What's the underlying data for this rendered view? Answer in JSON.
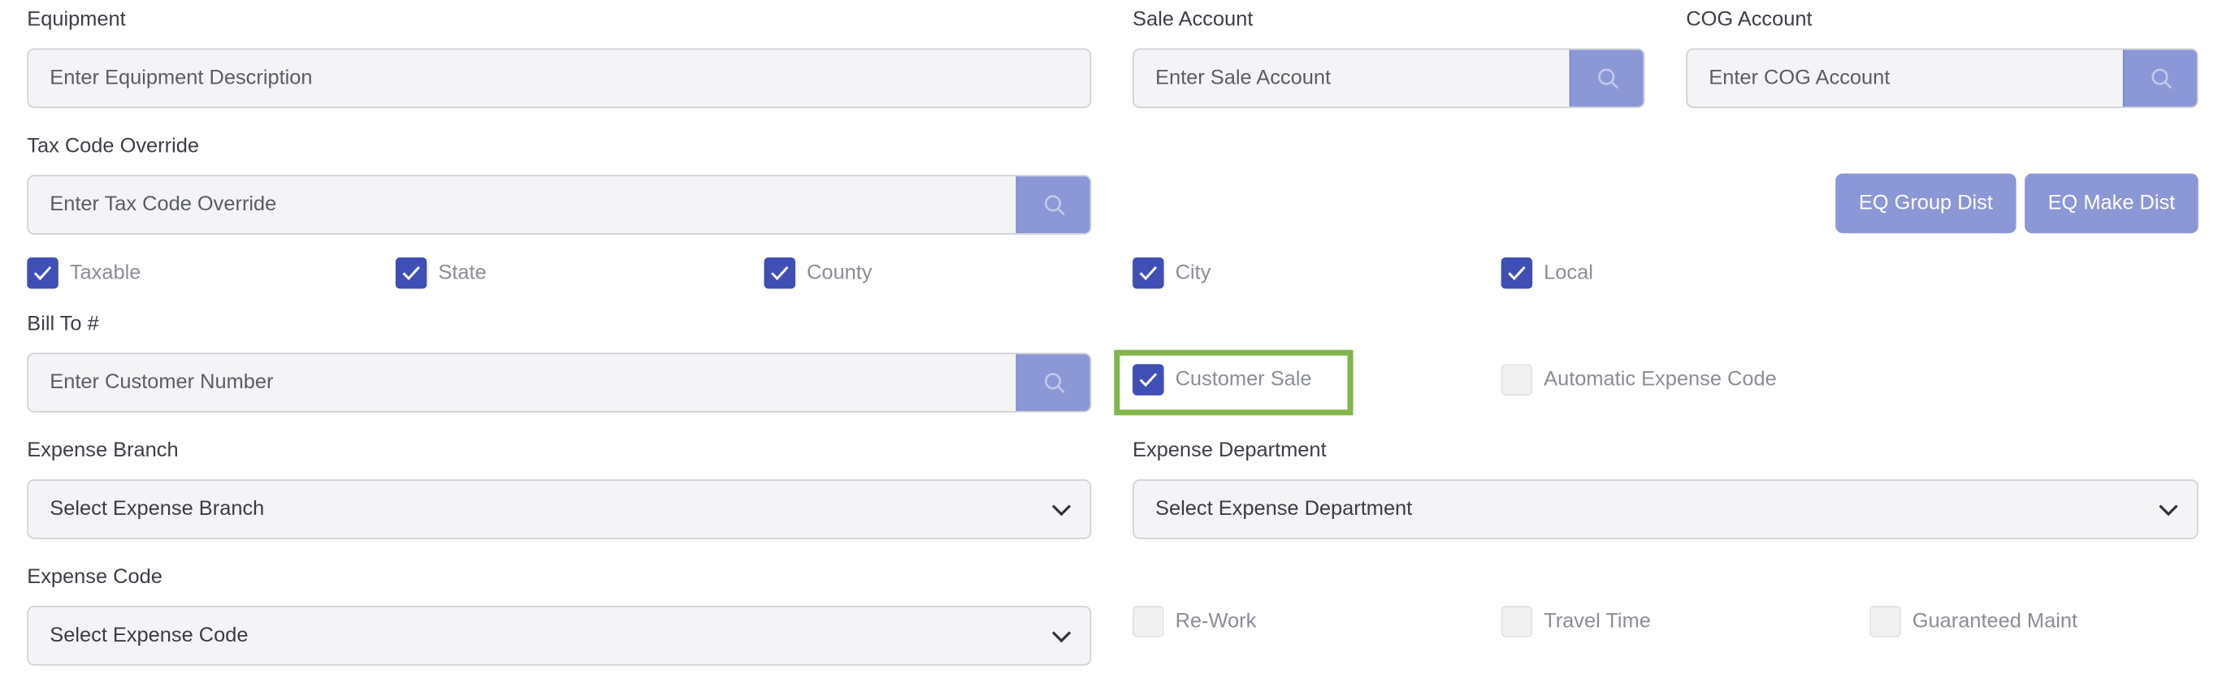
{
  "equipment": {
    "label": "Equipment",
    "placeholder": "Enter Equipment Description"
  },
  "sale_account": {
    "label": "Sale Account",
    "placeholder": "Enter Sale Account"
  },
  "cog_account": {
    "label": "COG Account",
    "placeholder": "Enter COG Account"
  },
  "tax_code_override": {
    "label": "Tax Code Override",
    "placeholder": "Enter Tax Code Override"
  },
  "buttons": {
    "eq_group_dist": "EQ Group Dist",
    "eq_make_dist": "EQ Make Dist"
  },
  "tax_checkboxes": [
    {
      "label": "Taxable",
      "checked": true
    },
    {
      "label": "State",
      "checked": true
    },
    {
      "label": "County",
      "checked": true
    },
    {
      "label": "City",
      "checked": true
    },
    {
      "label": "Local",
      "checked": true
    }
  ],
  "bill_to": {
    "label": "Bill To #",
    "placeholder": "Enter Customer Number"
  },
  "customer_sale": {
    "label": "Customer Sale",
    "checked": true
  },
  "automatic_expense_code": {
    "label": "Automatic Expense Code",
    "checked": false
  },
  "expense_branch": {
    "label": "Expense Branch",
    "value": "Select Expense Branch"
  },
  "expense_department": {
    "label": "Expense Department",
    "value": "Select Expense Department"
  },
  "expense_code": {
    "label": "Expense Code",
    "value": "Select Expense Code"
  },
  "flags": [
    {
      "label": "Re-Work",
      "checked": false
    },
    {
      "label": "Travel Time",
      "checked": false
    },
    {
      "label": "Guaranteed Maint",
      "checked": false
    }
  ],
  "colors": {
    "accent": "#8c97d6",
    "checkbox_checked": "#3f4fb5",
    "highlight": "#84b44d"
  },
  "icons": {
    "search": "search-icon",
    "dropdown": "chevron-down-icon",
    "check": "checkmark-icon"
  }
}
